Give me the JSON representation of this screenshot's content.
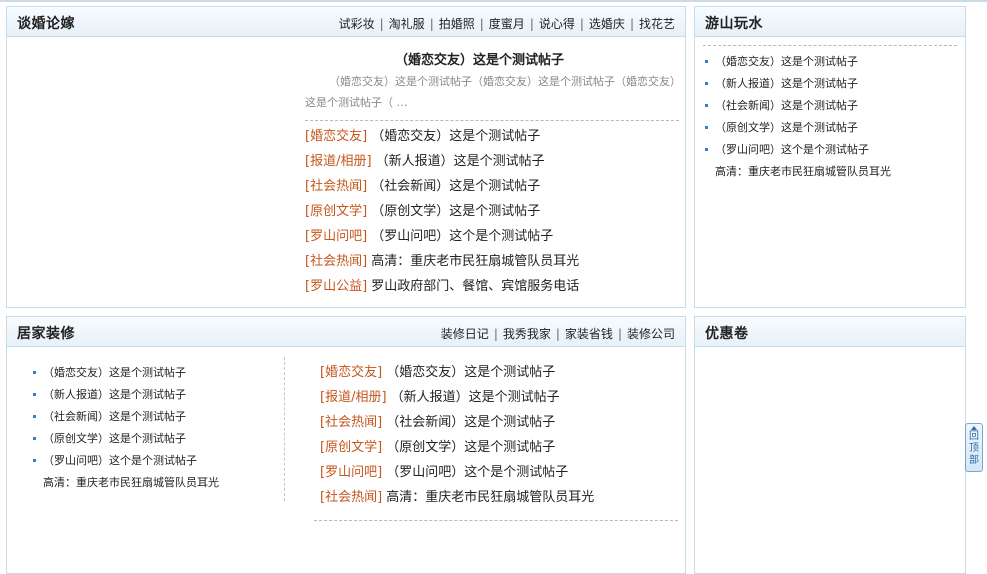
{
  "panels": {
    "wedding": {
      "title": "谈婚论嫁",
      "links": [
        "试彩妆",
        "淘礼服",
        "拍婚照",
        "度蜜月",
        "说心得",
        "选婚庆",
        "找花艺"
      ],
      "featured_title": "（婚恋交友）这是个测试帖子",
      "featured_summary": "（婚恋交友）这是个测试帖子（婚恋交友）这是个测试帖子（婚恋交友）这是个测试帖子（  …",
      "items": [
        {
          "cat": "[婚恋交友]",
          "title": "（婚恋交友）这是个测试帖子"
        },
        {
          "cat": "[报道/相册]",
          "title": "（新人报道）这是个测试帖子"
        },
        {
          "cat": "[社会热闻]",
          "title": "（社会新闻）这是个测试帖子"
        },
        {
          "cat": "[原创文学]",
          "title": "（原创文学）这是个测试帖子"
        },
        {
          "cat": "[罗山问吧]",
          "title": "（罗山问吧）这个是个测试帖子"
        },
        {
          "cat": "[社会热闻]",
          "title": "高清：重庆老市民狂扇城管队员耳光"
        },
        {
          "cat": "[罗山公益]",
          "title": "罗山政府部门、餐馆、宾馆服务电话"
        }
      ]
    },
    "travel": {
      "title": "游山玩水",
      "items": [
        {
          "text": "（婚恋交友）这是个测试帖子",
          "dot": true
        },
        {
          "text": "（新人报道）这是个测试帖子",
          "dot": true
        },
        {
          "text": "（社会新闻）这是个测试帖子",
          "dot": true
        },
        {
          "text": "（原创文学）这是个测试帖子",
          "dot": true
        },
        {
          "text": "（罗山问吧）这个是个测试帖子",
          "dot": true
        },
        {
          "text": "高清：重庆老市民狂扇城管队员耳光",
          "dot": false
        }
      ]
    },
    "home": {
      "title": "居家装修",
      "links": [
        "装修日记",
        "我秀我家",
        "家装省钱",
        "装修公司"
      ],
      "left_items": [
        {
          "text": "（婚恋交友）这是个测试帖子",
          "dot": true
        },
        {
          "text": "（新人报道）这是个测试帖子",
          "dot": true
        },
        {
          "text": "（社会新闻）这是个测试帖子",
          "dot": true
        },
        {
          "text": "（原创文学）这是个测试帖子",
          "dot": true
        },
        {
          "text": "（罗山问吧）这个是个测试帖子",
          "dot": true
        },
        {
          "text": "高清：重庆老市民狂扇城管队员耳光",
          "dot": false
        }
      ],
      "right_items": [
        {
          "cat": "[婚恋交友]",
          "title": "（婚恋交友）这是个测试帖子"
        },
        {
          "cat": "[报道/相册]",
          "title": "（新人报道）这是个测试帖子"
        },
        {
          "cat": "[社会热闻]",
          "title": "（社会新闻）这是个测试帖子"
        },
        {
          "cat": "[原创文学]",
          "title": "（原创文学）这是个测试帖子"
        },
        {
          "cat": "[罗山问吧]",
          "title": "（罗山问吧）这个是个测试帖子"
        },
        {
          "cat": "[社会热闻]",
          "title": "高清：重庆老市民狂扇城管队员耳光"
        }
      ]
    },
    "coupon": {
      "title": "优惠卷"
    }
  },
  "back_to_top": {
    "label": "回顶部",
    "icon": "arrow-up-icon"
  },
  "colors": {
    "category_text": "#c5571d",
    "panel_border": "#c7dbe8",
    "bullet": "#3a7ebf"
  }
}
